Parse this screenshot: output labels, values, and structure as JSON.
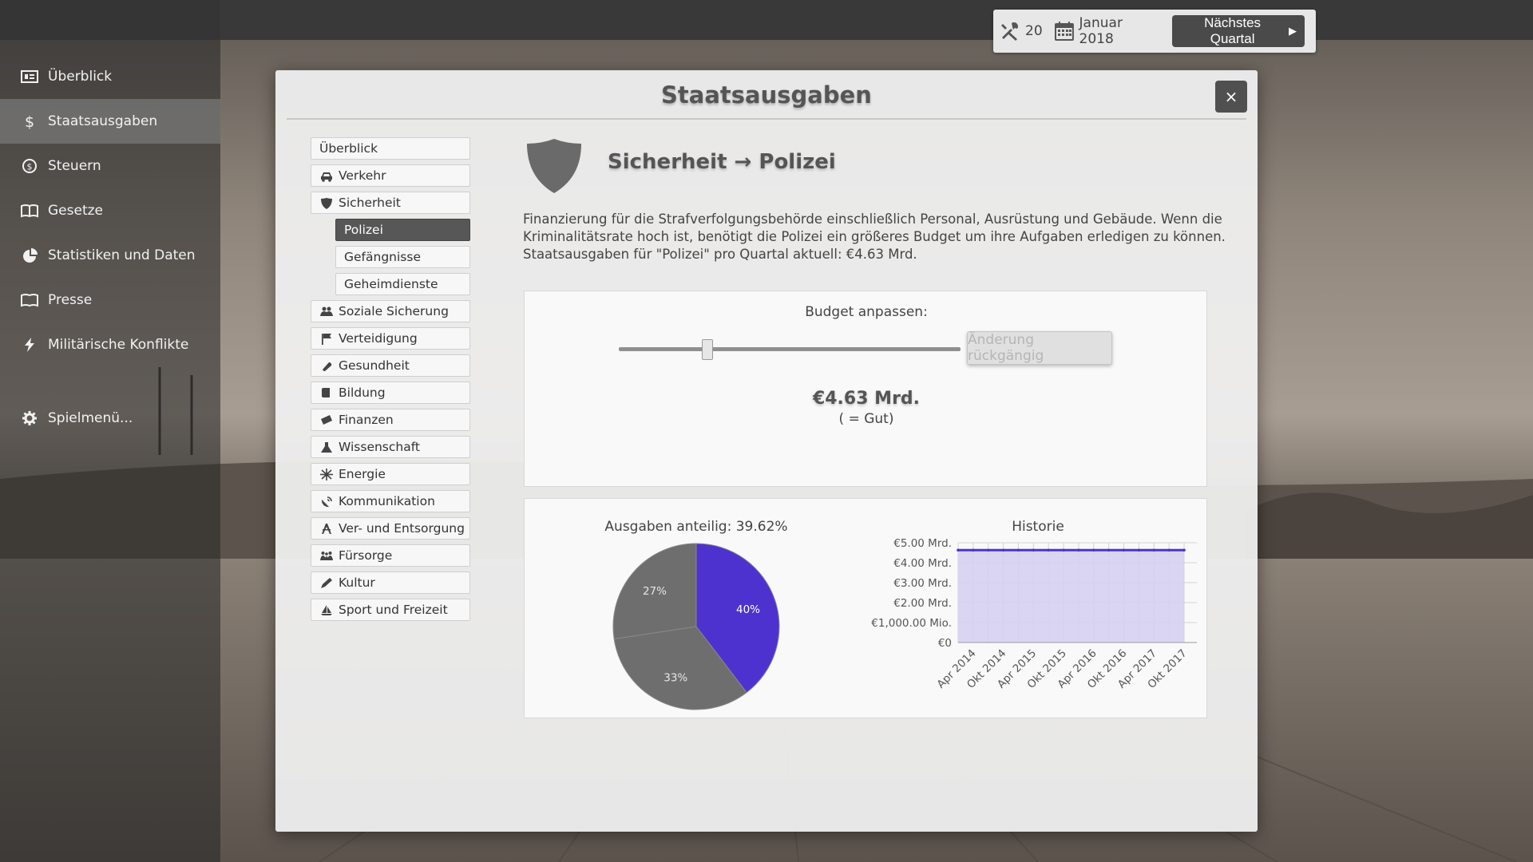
{
  "sidebar": {
    "items": [
      {
        "label": "Überblick",
        "icon": "overview-icon"
      },
      {
        "label": "Staatsausgaben",
        "icon": "dollar-icon"
      },
      {
        "label": "Steuern",
        "icon": "tax-coin-icon"
      },
      {
        "label": "Gesetze",
        "icon": "law-book-icon"
      },
      {
        "label": "Statistiken und Daten",
        "icon": "pie-chart-icon"
      },
      {
        "label": "Presse",
        "icon": "newspaper-icon"
      },
      {
        "label": "Militärische Konflikte",
        "icon": "lightning-icon"
      }
    ],
    "active_index": 1,
    "game_menu": {
      "label": "Spielmenü...",
      "icon": "gear-icon"
    }
  },
  "status": {
    "actions_count": "20",
    "date": "Januar 2018",
    "next_button": "Nächstes Quartal"
  },
  "modal": {
    "title": "Staatsausgaben",
    "close_label": "×",
    "categories": [
      {
        "label": "Überblick",
        "icon": "none"
      },
      {
        "label": "Verkehr",
        "icon": "car-icon"
      },
      {
        "label": "Sicherheit",
        "icon": "shield-icon"
      },
      {
        "label": "Polizei",
        "sub": true,
        "selected": true
      },
      {
        "label": "Gefängnisse",
        "sub": true
      },
      {
        "label": "Geheimdienste",
        "sub": true
      },
      {
        "label": "Soziale Sicherung",
        "icon": "people-icon"
      },
      {
        "label": "Verteidigung",
        "icon": "flag-icon"
      },
      {
        "label": "Gesundheit",
        "icon": "pill-icon"
      },
      {
        "label": "Bildung",
        "icon": "book-icon"
      },
      {
        "label": "Finanzen",
        "icon": "money-icon"
      },
      {
        "label": "Wissenschaft",
        "icon": "flask-icon"
      },
      {
        "label": "Energie",
        "icon": "energy-icon"
      },
      {
        "label": "Kommunikation",
        "icon": "satellite-icon"
      },
      {
        "label": "Ver- und Entsorgung",
        "icon": "tower-icon"
      },
      {
        "label": "Fürsorge",
        "icon": "family-icon"
      },
      {
        "label": "Kultur",
        "icon": "pen-icon"
      },
      {
        "label": "Sport und Freizeit",
        "icon": "sailboat-icon"
      }
    ],
    "detail": {
      "title": "Sicherheit → Polizei",
      "icon": "shield-icon",
      "description_1": "Finanzierung für die Strafverfolgungsbehörde einschließlich Personal, Ausrüstung und Gebäude. Wenn die Kriminalitätsrate hoch ist, benötigt die Polizei ein größeres Budget um ihre Aufgaben erledigen zu können.",
      "description_2": "Staatsausgaben für \"Polizei\" pro Quartal aktuell:  €4.63 Mrd."
    },
    "budget": {
      "label": "Budget anpassen:",
      "slider_level": 0.26,
      "undo_button": "Änderung rückgängig",
      "value": "€4.63 Mrd.",
      "rating": "( = Gut)"
    }
  },
  "colors": {
    "accent": "#4e32d0",
    "pie_grey": "#6e6e6e",
    "area_fill": "#d6cff3"
  },
  "chart_data": [
    {
      "type": "pie",
      "title": "Ausgaben anteilig: 39.62%",
      "slices": [
        {
          "label": "40%",
          "value": 39.62,
          "color": "#4e32d0"
        },
        {
          "label": "33%",
          "value": 33.0,
          "color": "#6e6e6e"
        },
        {
          "label": "27%",
          "value": 27.38,
          "color": "#6e6e6e"
        }
      ]
    },
    {
      "type": "area",
      "title": "Historie",
      "x_ticks": [
        "Apr 2014",
        "Okt 2014",
        "Apr 2015",
        "Okt 2015",
        "Apr 2016",
        "Okt 2016",
        "Apr 2017",
        "Okt 2017"
      ],
      "y_ticks": [
        "€0",
        "€1,000.00 Mio.",
        "€2.00 Mrd.",
        "€3.00 Mrd.",
        "€4.00 Mrd.",
        "€5.00 Mrd."
      ],
      "ylim": [
        0,
        5
      ],
      "x": [
        "Jan 2014",
        "Apr 2014",
        "Jul 2014",
        "Okt 2014",
        "Jan 2015",
        "Apr 2015",
        "Jul 2015",
        "Okt 2015",
        "Jan 2016",
        "Apr 2016",
        "Jul 2016",
        "Okt 2016",
        "Jan 2017",
        "Apr 2017",
        "Jul 2017",
        "Okt 2017"
      ],
      "values": [
        4.63,
        4.63,
        4.63,
        4.63,
        4.63,
        4.63,
        4.63,
        4.63,
        4.63,
        4.63,
        4.63,
        4.63,
        4.63,
        4.63,
        4.63,
        4.63
      ],
      "grid": true
    }
  ]
}
